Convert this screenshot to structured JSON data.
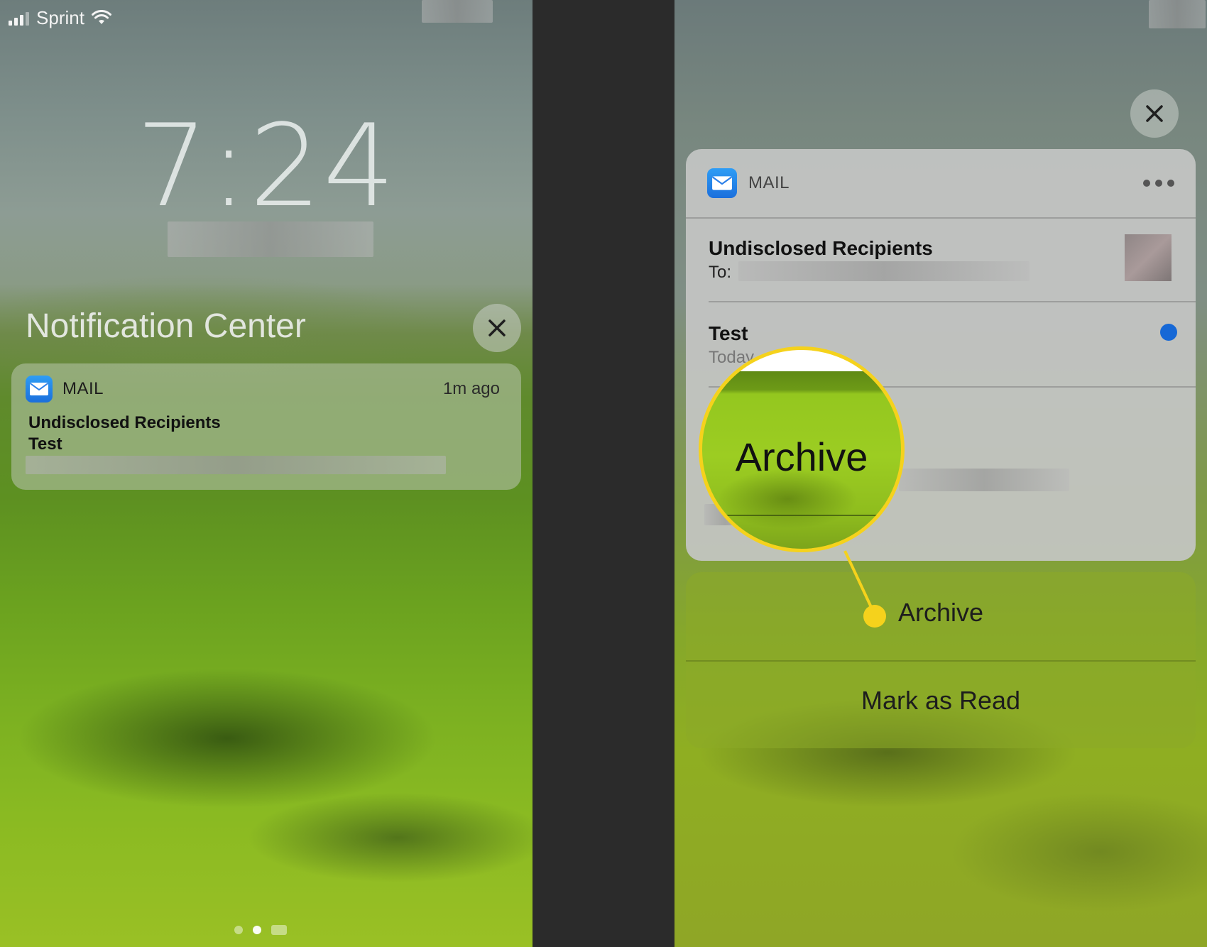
{
  "lock_screen": {
    "status": {
      "carrier": "Sprint"
    },
    "clock": "7:24",
    "notification_center_title": "Notification Center",
    "notification": {
      "app_name": "MAIL",
      "time_ago": "1m ago",
      "sender": "Undisclosed Recipients",
      "subject": "Test"
    }
  },
  "expanded_notification": {
    "app_name": "MAIL",
    "sender": "Undisclosed Recipients",
    "to_label": "To:",
    "subject": "Test",
    "date": "Today",
    "actions": [
      {
        "label": "Archive"
      },
      {
        "label": "Mark as Read"
      }
    ],
    "magnified_label": "Archive"
  },
  "colors": {
    "highlight": "#f5d21c",
    "unread_dot": "#1668d6",
    "mail_icon": "#1b6fdc"
  }
}
